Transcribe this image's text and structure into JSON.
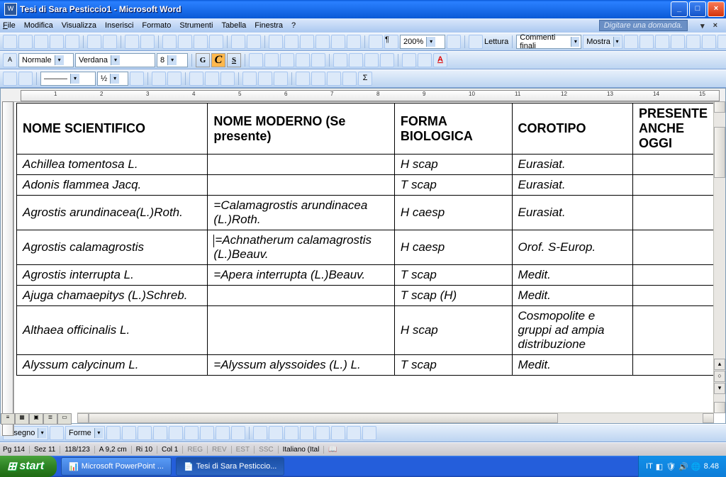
{
  "window": {
    "title": "Tesi di Sara Pesticcio1 - Microsoft Word"
  },
  "menu": {
    "file": "File",
    "modifica": "Modifica",
    "visualizza": "Visualizza",
    "inserisci": "Inserisci",
    "formato": "Formato",
    "strumenti": "Strumenti",
    "tabella": "Tabella",
    "finestra": "Finestra",
    "help": "?",
    "ask": "Digitare una domanda."
  },
  "toolbar": {
    "zoom": "200%",
    "lettura": "Lettura",
    "revisions": "Commenti finali",
    "mostra": "Mostra"
  },
  "format": {
    "style": "Normale",
    "font": "Verdana",
    "size": "8",
    "G": "G",
    "C": "C",
    "S": "S"
  },
  "ruler": [
    "1",
    "2",
    "3",
    "4",
    "5",
    "6",
    "7",
    "8",
    "9",
    "10",
    "11",
    "12",
    "13",
    "14",
    "15"
  ],
  "table": {
    "headers": [
      "NOME SCIENTIFICO",
      "NOME MODERNO (Se presente)",
      "FORMA BIOLOGICA",
      "COROTIPO",
      "PRESENTE ANCHE OGGI"
    ],
    "rows": [
      [
        "Achillea tomentosa L.",
        "",
        "H scap",
        "Eurasiat.",
        ""
      ],
      [
        "Adonis flammea Jacq.",
        "",
        "T scap",
        "Eurasiat.",
        ""
      ],
      [
        "Agrostis arundinacea(L.)Roth.",
        "=Calamagrostis arundinacea (L.)Roth.",
        "H caesp",
        "Eurasiat.",
        ""
      ],
      [
        "Agrostis calamagrostis",
        "=Achnatherum calamagrostis (L.)Beauv.",
        "H caesp",
        "Orof. S-Europ.",
        ""
      ],
      [
        "Agrostis interrupta L.",
        "=Apera interrupta (L.)Beauv.",
        "T scap",
        "Medit.",
        ""
      ],
      [
        "Ajuga chamaepitys (L.)Schreb.",
        "",
        "T scap (H)",
        "Medit.",
        ""
      ],
      [
        "Althaea officinalis L.",
        "",
        "H scap",
        "Cosmopolite e gruppi ad ampia distribuzione",
        ""
      ],
      [
        "Alyssum calycinum L.",
        "=Alyssum alyssoides (L.) L.",
        "T scap",
        "Medit.",
        ""
      ]
    ]
  },
  "drawbar": {
    "disegno": "Disegno",
    "forme": "Forme"
  },
  "status": {
    "pg": "Pg  114",
    "sez": "Sez  11",
    "pages": "118/123",
    "at": "A  9,2 cm",
    "ri": "Ri  10",
    "col": "Col  1",
    "reg": "REG",
    "rev": "REV",
    "est": "EST",
    "ssc": "SSC",
    "lang": "Italiano (Ital"
  },
  "taskbar": {
    "start": "start",
    "t1": "Microsoft PowerPoint ...",
    "t2": "Tesi di Sara Pesticcio...",
    "lang": "IT",
    "time": "8.48"
  }
}
